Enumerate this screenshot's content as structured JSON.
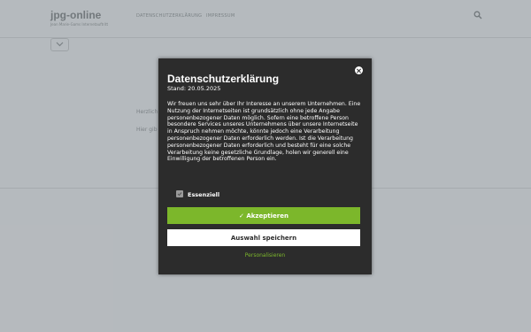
{
  "site": {
    "logo": "jpg-online",
    "tagline": "Jean Marie-Gams Internetauftritt",
    "nav": [
      "DATENSCHUTZERKLÄRUNG",
      "IMPRESSUM"
    ],
    "search_icon": "search-icon",
    "bg_text_1": "Herzlich",
    "bg_text_2": "Hier gib"
  },
  "modal": {
    "title": "Datenschutzerklärung",
    "date": "Stand: 20.05.2025",
    "body": "Wir freuen uns sehr über Ihr Interesse an unserem Unternehmen. Eine Nutzung der Internetseiten ist grundsätzlich ohne jede Angabe personenbezogener Daten möglich. Sofern eine betroffene Person besondere Services unseres Unternehmens über unsere Internetseite in Anspruch nehmen möchte, könnte jedoch eine Verarbeitung personenbezogener Daten erforderlich werden. Ist die Verarbeitung personenbezogener Daten erforderlich und besteht für eine solche Verarbeitung keine gesetzliche Grundlage, holen wir generell eine Einwilligung der betroffenen Person ein.",
    "checkbox_label": "Essenziell",
    "checkbox_checked": true,
    "accept_label": "✓ Akzeptieren",
    "save_label": "Auswahl speichern",
    "personalize_label": "Personalisieren",
    "accent_color": "#7cb72b",
    "modal_bg": "#2c2c2c"
  }
}
